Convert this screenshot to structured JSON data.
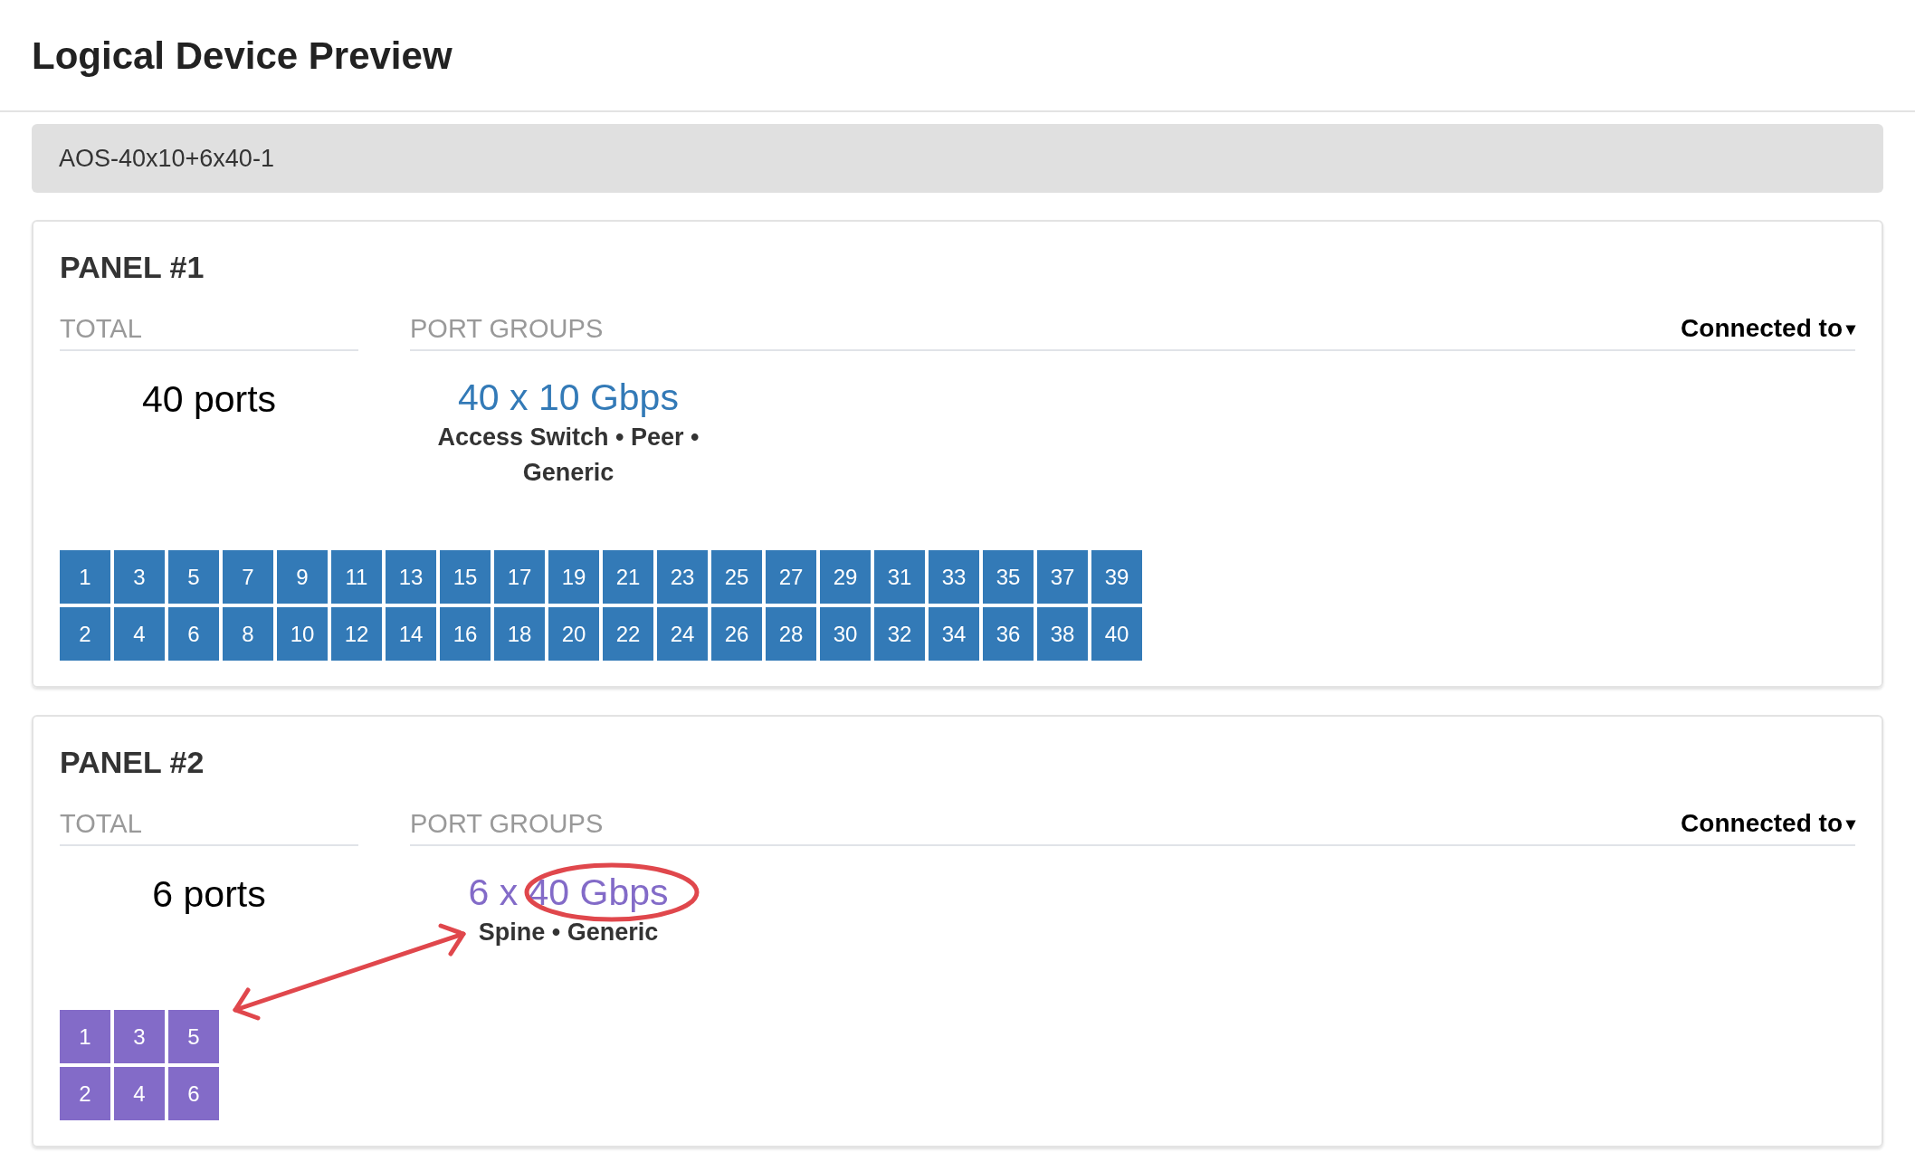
{
  "page": {
    "title": "Logical Device Preview"
  },
  "device": {
    "name": "AOS-40x10+6x40-1"
  },
  "panels": [
    {
      "title": "PANEL #1",
      "total_label": "TOTAL",
      "total": "40 ports",
      "groups_label": "PORT GROUPS",
      "connected_to": "Connected to",
      "caret": "▾",
      "groups": [
        {
          "speed": "40 x 10 Gbps",
          "roles": "Access Switch • Peer • Generic",
          "color": "#337ab7"
        }
      ],
      "ports": [
        "1",
        "2",
        "3",
        "4",
        "5",
        "6",
        "7",
        "8",
        "9",
        "10",
        "11",
        "12",
        "13",
        "14",
        "15",
        "16",
        "17",
        "18",
        "19",
        "20",
        "21",
        "22",
        "23",
        "24",
        "25",
        "26",
        "27",
        "28",
        "29",
        "30",
        "31",
        "32",
        "33",
        "34",
        "35",
        "36",
        "37",
        "38",
        "39",
        "40"
      ]
    },
    {
      "title": "PANEL #2",
      "total_label": "TOTAL",
      "total": "6 ports",
      "groups_label": "PORT GROUPS",
      "connected_to": "Connected to",
      "caret": "▾",
      "groups": [
        {
          "speed": "6 x 40 Gbps",
          "roles": "Spine • Generic",
          "color": "#836bc8",
          "circled": true
        }
      ],
      "ports": [
        "1",
        "2",
        "3",
        "4",
        "5",
        "6"
      ],
      "arrow_to_ports": true
    }
  ]
}
